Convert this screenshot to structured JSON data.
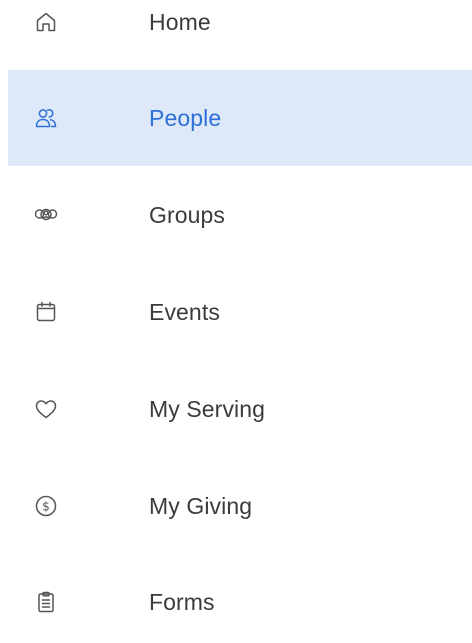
{
  "nav": {
    "items": [
      {
        "label": "Home",
        "icon": "home-icon",
        "active": false
      },
      {
        "label": "People",
        "icon": "people-icon",
        "active": true
      },
      {
        "label": "Groups",
        "icon": "groups-icon",
        "active": false
      },
      {
        "label": "Events",
        "icon": "calendar-icon",
        "active": false
      },
      {
        "label": "My Serving",
        "icon": "heart-icon",
        "active": false
      },
      {
        "label": "My Giving",
        "icon": "dollar-circle-icon",
        "active": false
      },
      {
        "label": "Forms",
        "icon": "clipboard-icon",
        "active": false
      }
    ],
    "colors": {
      "active_bg": "#dde9f8",
      "active_text": "#2e6fd8",
      "text": "#3b3b3b",
      "icon": "#555555"
    }
  }
}
